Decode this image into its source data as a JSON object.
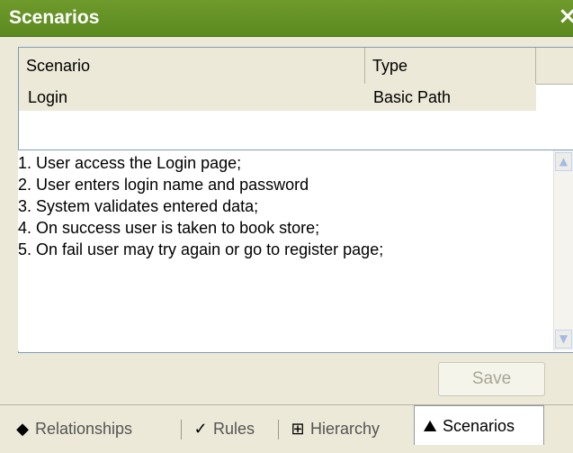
{
  "window": {
    "title": "Scenarios",
    "close_glyph": "×"
  },
  "grid": {
    "columns": [
      "Scenario",
      "Type"
    ],
    "rows": [
      {
        "name": "Login",
        "type": "Basic Path"
      }
    ]
  },
  "description": {
    "lines": [
      "1. User access the Login page;",
      "2. User enters login name and password",
      "3. System validates entered data;",
      "4. On success user is taken to book store;",
      "5. On fail user may try again or go to register page;"
    ]
  },
  "save_label": "Save",
  "tabs": [
    {
      "label": "Relationships",
      "icon": "relationships-icon"
    },
    {
      "label": "Rules",
      "icon": "checkmark-icon"
    },
    {
      "label": "Hierarchy",
      "icon": "hierarchy-icon"
    },
    {
      "label": "Scenarios",
      "icon": "scenarios-icon",
      "active": true
    }
  ]
}
